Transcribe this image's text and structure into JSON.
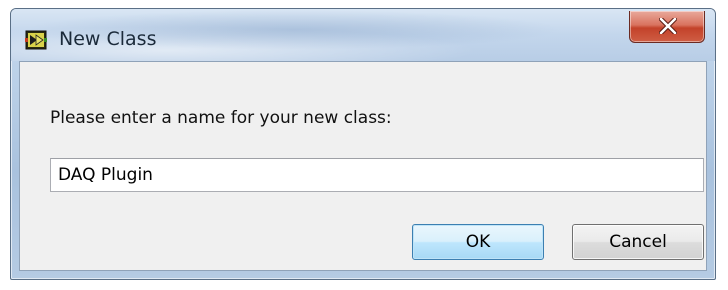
{
  "window": {
    "title": "New Class",
    "app_icon": "labview-class-icon",
    "close_icon": "close-icon"
  },
  "dialog": {
    "prompt": "Please enter a name for your new class:",
    "name_value": "DAQ Plugin",
    "ok_label": "OK",
    "cancel_label": "Cancel"
  },
  "colors": {
    "close_button": "#c7472f",
    "default_button_border": "#3c7fb1",
    "client_background": "#f0f0f0"
  }
}
